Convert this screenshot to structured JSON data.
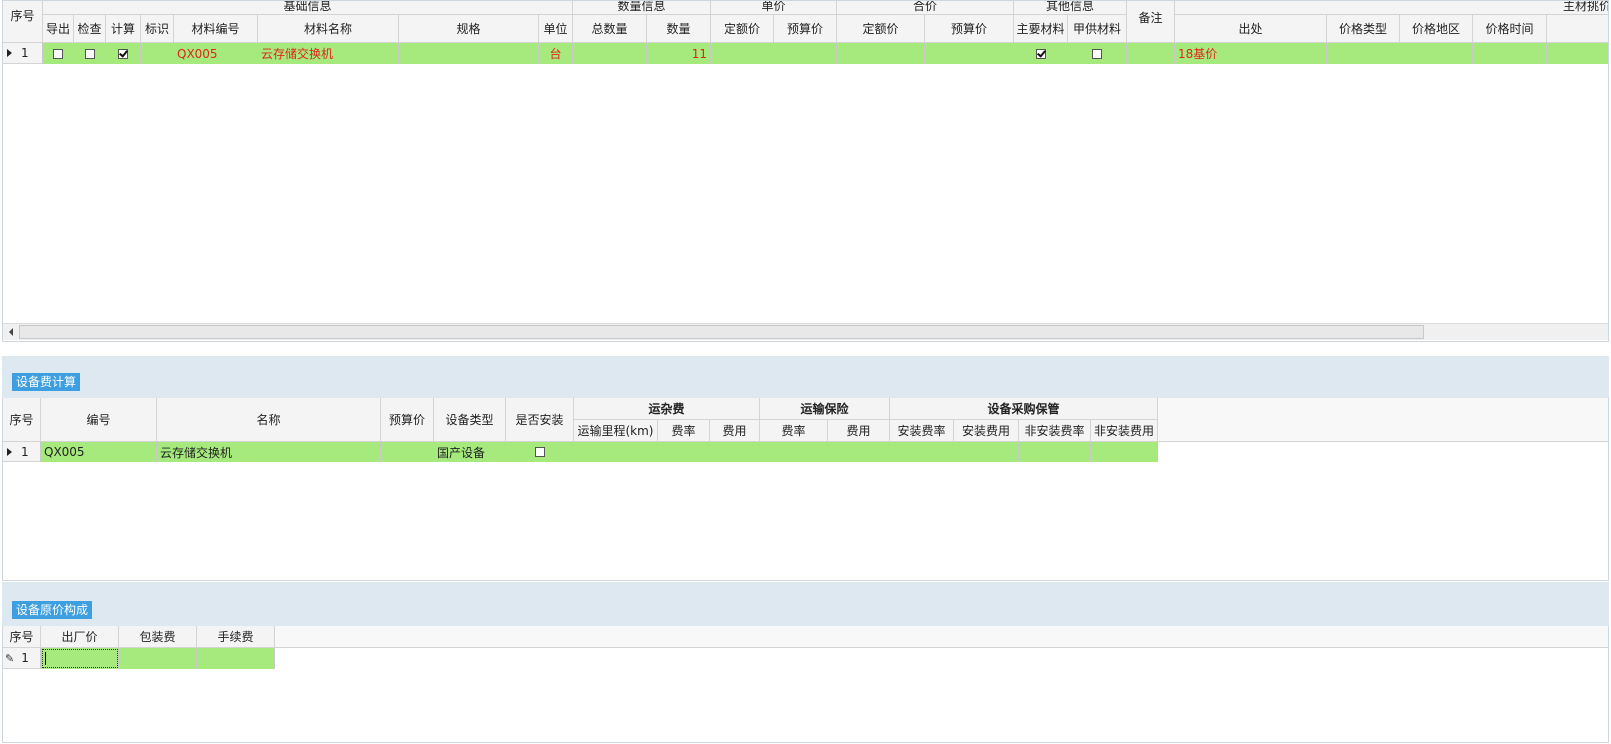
{
  "top_grid": {
    "group_headers": [
      "基础信息",
      "数量信息",
      "单价",
      "合价",
      "其他信息",
      "主材挑价"
    ],
    "columns": {
      "seq": "序号",
      "export": "导出",
      "check": "检查",
      "calc": "计算",
      "mark": "标识",
      "code": "材料编号",
      "name": "材料名称",
      "spec": "规格",
      "unit": "单位",
      "total_qty": "总数量",
      "qty": "数量",
      "quota_price": "定额价",
      "budget_price": "预算价",
      "quota_total": "定额价",
      "budget_total": "预算价",
      "main_material": "主要材料",
      "supplied": "甲供材料",
      "remark": "备注",
      "source": "出处",
      "price_type": "价格类型",
      "price_region": "价格地区",
      "price_time": "价格时间"
    },
    "rows": [
      {
        "seq": "1",
        "export": false,
        "check": false,
        "calc": true,
        "code": "QX005",
        "name": "云存储交换机",
        "spec": "",
        "unit": "台",
        "total_qty": "",
        "qty": "11",
        "main_material": true,
        "supplied": false,
        "source": "18基价"
      }
    ]
  },
  "equipment_fee": {
    "title": "设备费计算",
    "columns": {
      "seq": "序号",
      "code": "编号",
      "name": "名称",
      "budget_price": "预算价",
      "equip_type": "设备类型",
      "installed": "是否安装",
      "freight_group": "运杂费",
      "mileage": "运输里程(km)",
      "freight_rate": "费率",
      "freight_cost": "费用",
      "insurance_group": "运输保险",
      "ins_rate": "费率",
      "ins_cost": "费用",
      "purchase_group": "设备采购保管",
      "inst_rate": "安装费率",
      "inst_cost": "安装费用",
      "noninst_rate": "非安装费率",
      "noninst_cost": "非安装费用"
    },
    "rows": [
      {
        "seq": "1",
        "code": "QX005",
        "name": "云存储交换机",
        "equip_type": "国产设备",
        "installed": false
      }
    ]
  },
  "original_price": {
    "title": "设备原价构成",
    "columns": {
      "seq": "序号",
      "factory_price": "出厂价",
      "packing_fee": "包装费",
      "handling_fee": "手续费"
    },
    "rows": [
      {
        "seq": "1"
      }
    ]
  },
  "colors": {
    "row_green": "#a6ea7e",
    "accent_blue": "#3d9ee0",
    "band": "#dde8f1",
    "red_text": "#e0241b"
  }
}
